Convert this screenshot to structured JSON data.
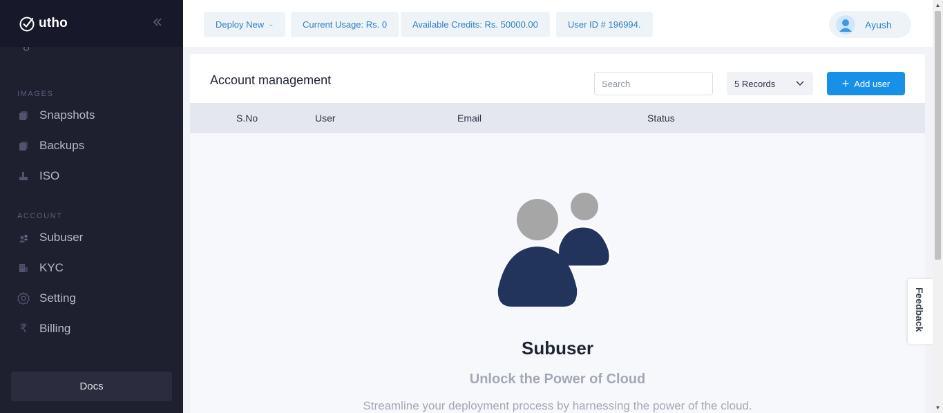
{
  "brand": {
    "name": "utho"
  },
  "sidebar": {
    "sections": {
      "images": "IMAGES",
      "account": "ACCOUNT"
    },
    "items": [
      {
        "label": "Snapshots",
        "icon": "snapshot-icon"
      },
      {
        "label": "Backups",
        "icon": "backup-icon"
      },
      {
        "label": "ISO",
        "icon": "iso-icon"
      },
      {
        "label": "Subuser",
        "icon": "subuser-icon"
      },
      {
        "label": "KYC",
        "icon": "kyc-icon"
      },
      {
        "label": "Setting",
        "icon": "gear-icon"
      },
      {
        "label": "Billing",
        "icon": "rupee-icon"
      }
    ],
    "docs_label": "Docs"
  },
  "topbar": {
    "deploy_label": "Deploy New",
    "usage": "Current Usage: Rs. 0",
    "credits": "Available Credits: Rs. 50000.00",
    "user_id": "User ID # 196994.",
    "user_name": "Ayush"
  },
  "main": {
    "title": "Account management",
    "search_placeholder": "Search",
    "records": "5 Records",
    "add_user_label": "Add user",
    "columns": [
      "S.No",
      "User",
      "Email",
      "Status"
    ],
    "empty": {
      "title": "Subuser",
      "subtitle": "Unlock the Power of Cloud",
      "description": "Streamline your deployment process by harnessing the power of the cloud."
    }
  },
  "feedback_label": "Feedback",
  "colors": {
    "accent": "#1790e8",
    "sidebar_bg": "#1e1f2f",
    "illustration_dark": "#22335c",
    "illustration_light": "#a6a6a6"
  }
}
